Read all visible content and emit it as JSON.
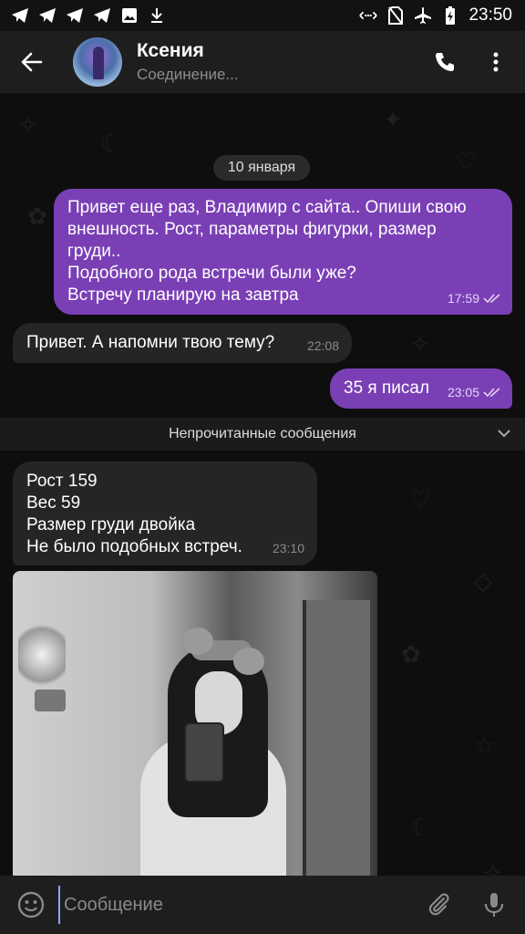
{
  "status_bar": {
    "time": "23:50",
    "left_icons": [
      "telegram-icon",
      "telegram-icon",
      "telegram-icon",
      "telegram-icon",
      "image-icon",
      "download-icon"
    ],
    "right_icons": [
      "data-saver-icon",
      "no-sim-icon",
      "airplane-icon",
      "battery-charging-icon"
    ]
  },
  "header": {
    "name": "Ксения",
    "status": "Соединение..."
  },
  "chat": {
    "date_label": "10 января",
    "unread_label": "Непрочитанные сообщения",
    "messages": [
      {
        "direction": "out",
        "text": "Привет еще раз, Владимир с сайта.. Опиши свою\nвнешность. Рост, параметры фигурки, размер\nгруди..\nПодобного рода встречи были уже?\nВстречу планирую на завтра",
        "time": "17:59",
        "read": true
      },
      {
        "direction": "in",
        "text": "Привет. А напомни твою тему?",
        "time": "22:08"
      },
      {
        "direction": "out",
        "text": "35 я писал",
        "time": "23:05",
        "read": true
      },
      {
        "direction": "in",
        "text": "Рост 159\nВес 59\nРазмер груди двойка\nНе было подобных встреч.",
        "time": "23:10"
      }
    ]
  },
  "composer": {
    "placeholder": "Сообщение"
  },
  "colors": {
    "outgoing_bubble": "#7a3fb5",
    "incoming_bubble": "#252525",
    "header": "#1e1e1e"
  }
}
